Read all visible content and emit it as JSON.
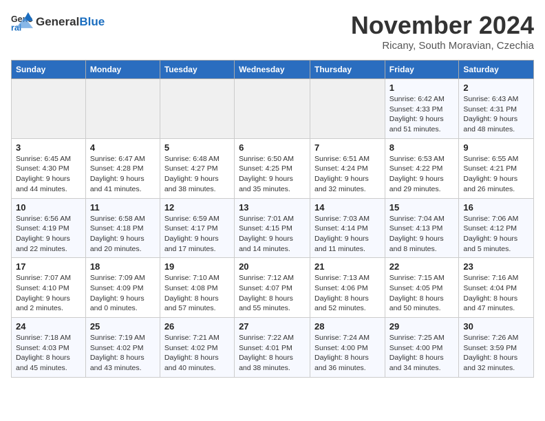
{
  "header": {
    "logo_line1": "General",
    "logo_line2": "Blue",
    "month_title": "November 2024",
    "location": "Ricany, South Moravian, Czechia"
  },
  "weekdays": [
    "Sunday",
    "Monday",
    "Tuesday",
    "Wednesday",
    "Thursday",
    "Friday",
    "Saturday"
  ],
  "weeks": [
    [
      {
        "day": "",
        "info": ""
      },
      {
        "day": "",
        "info": ""
      },
      {
        "day": "",
        "info": ""
      },
      {
        "day": "",
        "info": ""
      },
      {
        "day": "",
        "info": ""
      },
      {
        "day": "1",
        "info": "Sunrise: 6:42 AM\nSunset: 4:33 PM\nDaylight: 9 hours and 51 minutes."
      },
      {
        "day": "2",
        "info": "Sunrise: 6:43 AM\nSunset: 4:31 PM\nDaylight: 9 hours and 48 minutes."
      }
    ],
    [
      {
        "day": "3",
        "info": "Sunrise: 6:45 AM\nSunset: 4:30 PM\nDaylight: 9 hours and 44 minutes."
      },
      {
        "day": "4",
        "info": "Sunrise: 6:47 AM\nSunset: 4:28 PM\nDaylight: 9 hours and 41 minutes."
      },
      {
        "day": "5",
        "info": "Sunrise: 6:48 AM\nSunset: 4:27 PM\nDaylight: 9 hours and 38 minutes."
      },
      {
        "day": "6",
        "info": "Sunrise: 6:50 AM\nSunset: 4:25 PM\nDaylight: 9 hours and 35 minutes."
      },
      {
        "day": "7",
        "info": "Sunrise: 6:51 AM\nSunset: 4:24 PM\nDaylight: 9 hours and 32 minutes."
      },
      {
        "day": "8",
        "info": "Sunrise: 6:53 AM\nSunset: 4:22 PM\nDaylight: 9 hours and 29 minutes."
      },
      {
        "day": "9",
        "info": "Sunrise: 6:55 AM\nSunset: 4:21 PM\nDaylight: 9 hours and 26 minutes."
      }
    ],
    [
      {
        "day": "10",
        "info": "Sunrise: 6:56 AM\nSunset: 4:19 PM\nDaylight: 9 hours and 22 minutes."
      },
      {
        "day": "11",
        "info": "Sunrise: 6:58 AM\nSunset: 4:18 PM\nDaylight: 9 hours and 20 minutes."
      },
      {
        "day": "12",
        "info": "Sunrise: 6:59 AM\nSunset: 4:17 PM\nDaylight: 9 hours and 17 minutes."
      },
      {
        "day": "13",
        "info": "Sunrise: 7:01 AM\nSunset: 4:15 PM\nDaylight: 9 hours and 14 minutes."
      },
      {
        "day": "14",
        "info": "Sunrise: 7:03 AM\nSunset: 4:14 PM\nDaylight: 9 hours and 11 minutes."
      },
      {
        "day": "15",
        "info": "Sunrise: 7:04 AM\nSunset: 4:13 PM\nDaylight: 9 hours and 8 minutes."
      },
      {
        "day": "16",
        "info": "Sunrise: 7:06 AM\nSunset: 4:12 PM\nDaylight: 9 hours and 5 minutes."
      }
    ],
    [
      {
        "day": "17",
        "info": "Sunrise: 7:07 AM\nSunset: 4:10 PM\nDaylight: 9 hours and 2 minutes."
      },
      {
        "day": "18",
        "info": "Sunrise: 7:09 AM\nSunset: 4:09 PM\nDaylight: 9 hours and 0 minutes."
      },
      {
        "day": "19",
        "info": "Sunrise: 7:10 AM\nSunset: 4:08 PM\nDaylight: 8 hours and 57 minutes."
      },
      {
        "day": "20",
        "info": "Sunrise: 7:12 AM\nSunset: 4:07 PM\nDaylight: 8 hours and 55 minutes."
      },
      {
        "day": "21",
        "info": "Sunrise: 7:13 AM\nSunset: 4:06 PM\nDaylight: 8 hours and 52 minutes."
      },
      {
        "day": "22",
        "info": "Sunrise: 7:15 AM\nSunset: 4:05 PM\nDaylight: 8 hours and 50 minutes."
      },
      {
        "day": "23",
        "info": "Sunrise: 7:16 AM\nSunset: 4:04 PM\nDaylight: 8 hours and 47 minutes."
      }
    ],
    [
      {
        "day": "24",
        "info": "Sunrise: 7:18 AM\nSunset: 4:03 PM\nDaylight: 8 hours and 45 minutes."
      },
      {
        "day": "25",
        "info": "Sunrise: 7:19 AM\nSunset: 4:02 PM\nDaylight: 8 hours and 43 minutes."
      },
      {
        "day": "26",
        "info": "Sunrise: 7:21 AM\nSunset: 4:02 PM\nDaylight: 8 hours and 40 minutes."
      },
      {
        "day": "27",
        "info": "Sunrise: 7:22 AM\nSunset: 4:01 PM\nDaylight: 8 hours and 38 minutes."
      },
      {
        "day": "28",
        "info": "Sunrise: 7:24 AM\nSunset: 4:00 PM\nDaylight: 8 hours and 36 minutes."
      },
      {
        "day": "29",
        "info": "Sunrise: 7:25 AM\nSunset: 4:00 PM\nDaylight: 8 hours and 34 minutes."
      },
      {
        "day": "30",
        "info": "Sunrise: 7:26 AM\nSunset: 3:59 PM\nDaylight: 8 hours and 32 minutes."
      }
    ]
  ]
}
